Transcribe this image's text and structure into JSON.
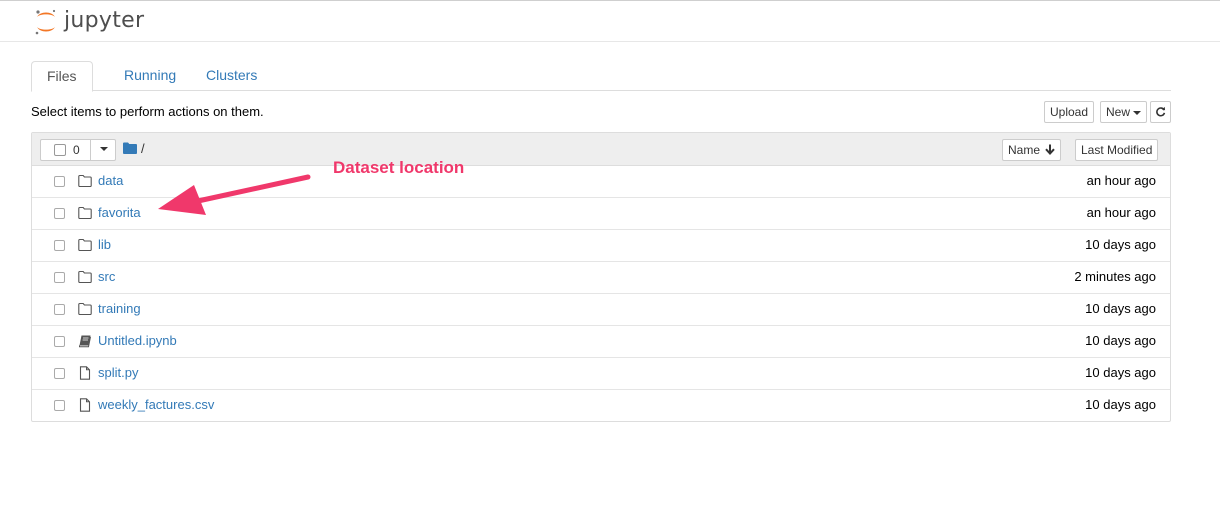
{
  "app": {
    "name": "jupyter"
  },
  "tabs": [
    {
      "label": "Files",
      "active": true
    },
    {
      "label": "Running",
      "active": false
    },
    {
      "label": "Clusters",
      "active": false
    }
  ],
  "toolbar": {
    "hint": "Select items to perform actions on them.",
    "upload_label": "Upload",
    "new_label": "New",
    "refresh_icon": "refresh-icon"
  },
  "list_header": {
    "selected_count": "0",
    "breadcrumb": "/",
    "sort_name_label": "Name",
    "sort_modified_label": "Last Modified"
  },
  "files": [
    {
      "name": "data",
      "type": "folder",
      "modified": "an hour ago"
    },
    {
      "name": "favorita",
      "type": "folder",
      "modified": "an hour ago"
    },
    {
      "name": "lib",
      "type": "folder",
      "modified": "10 days ago"
    },
    {
      "name": "src",
      "type": "folder",
      "modified": "2 minutes ago"
    },
    {
      "name": "training",
      "type": "folder",
      "modified": "10 days ago"
    },
    {
      "name": "Untitled.ipynb",
      "type": "notebook",
      "modified": "10 days ago"
    },
    {
      "name": "split.py",
      "type": "file",
      "modified": "10 days ago"
    },
    {
      "name": "weekly_factures.csv",
      "type": "file",
      "modified": "10 days ago"
    }
  ],
  "annotation": {
    "text": "Dataset location",
    "color": "#f0386b"
  },
  "colors": {
    "link": "#337ab7",
    "jupyter_orange": "#f37726"
  }
}
